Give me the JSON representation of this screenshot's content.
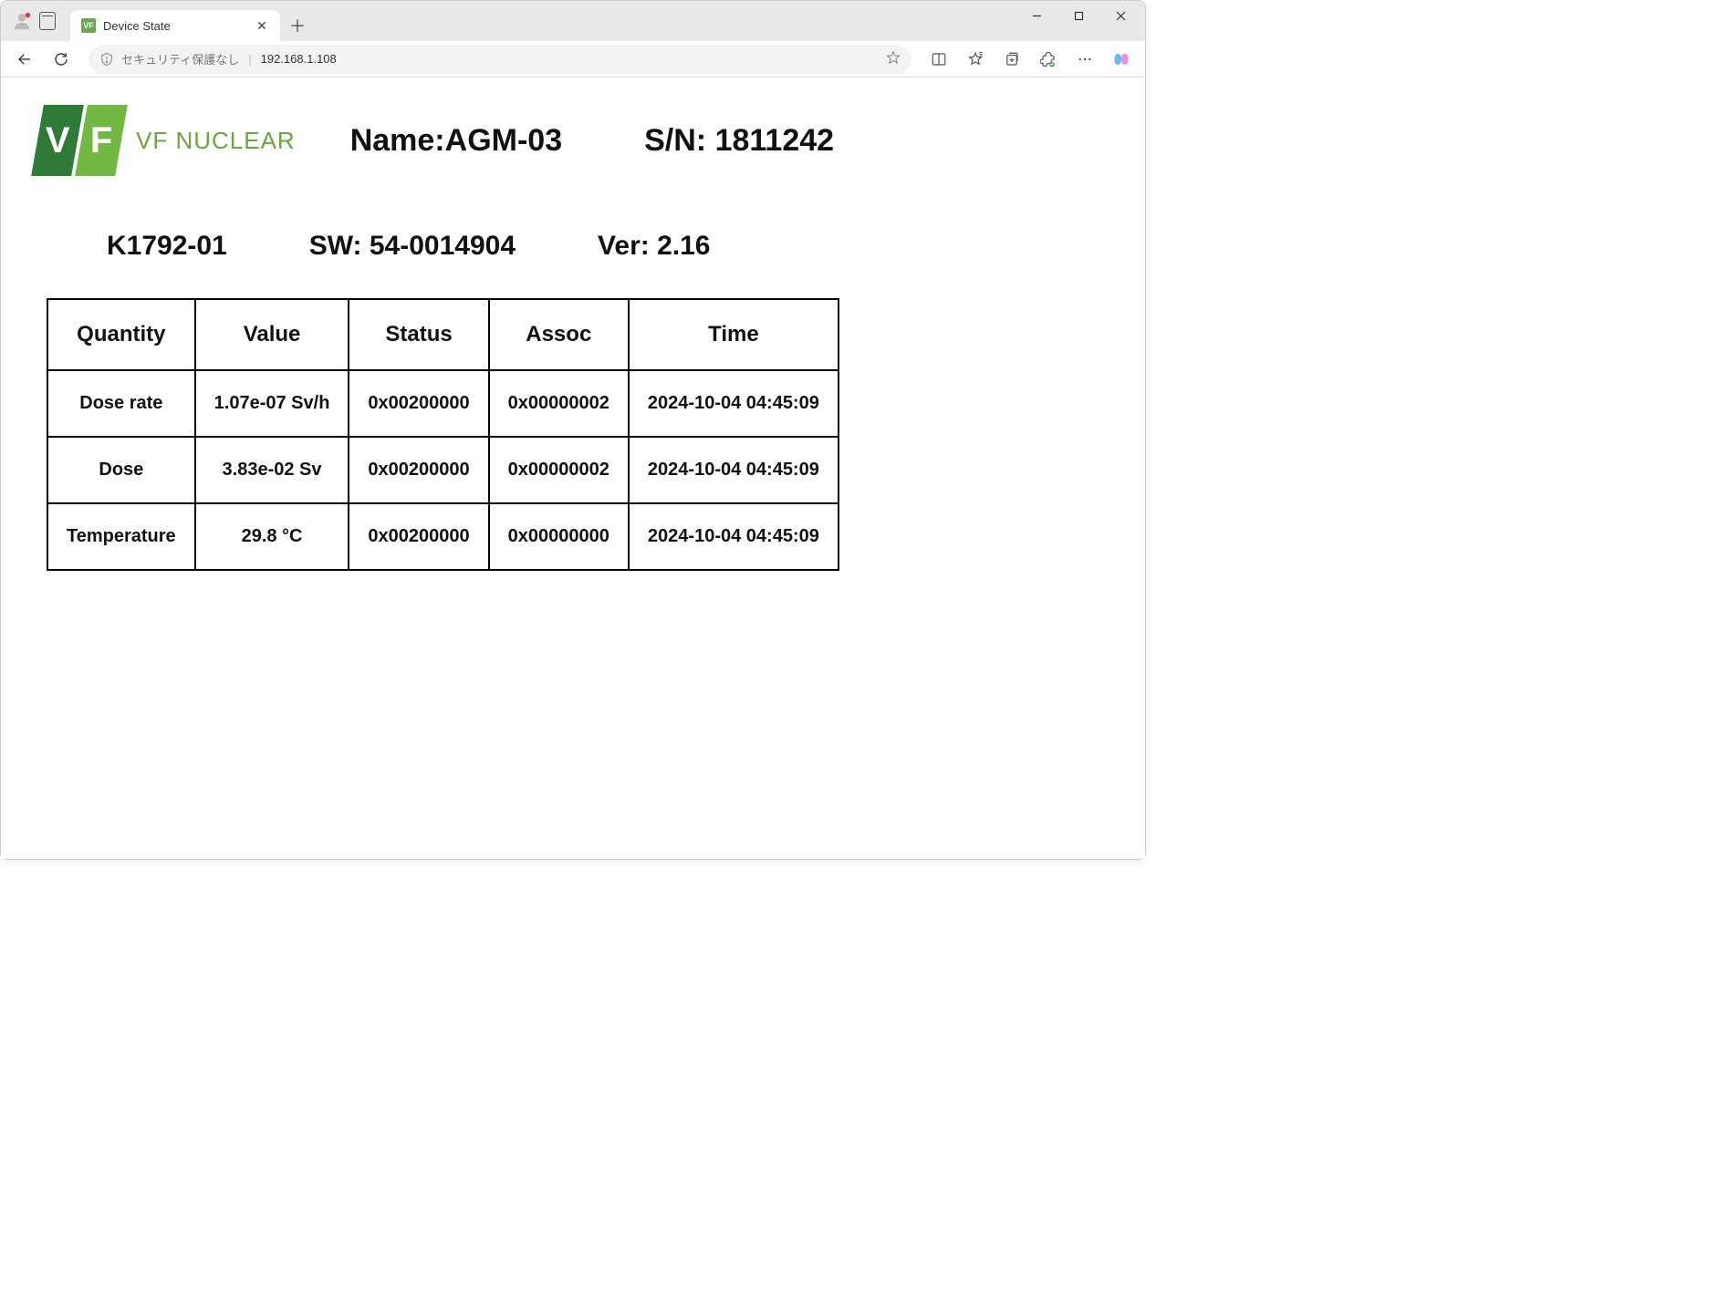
{
  "browser": {
    "tab_title": "Device State",
    "security_text": "セキュリティ保護なし",
    "url": "192.168.1.108"
  },
  "logo": {
    "letter1": "V",
    "letter2": "F",
    "brand_text": "VF NUCLEAR"
  },
  "header": {
    "name_label": "Name:",
    "name_value": "AGM-03",
    "sn_label": "S/N: ",
    "sn_value": "1811242"
  },
  "meta": {
    "model": "K1792-01",
    "sw_label": "SW: ",
    "sw_value": "54-0014904",
    "ver_label": "Ver: ",
    "ver_value": "2.16"
  },
  "table": {
    "headers": [
      "Quantity",
      "Value",
      "Status",
      "Assoc",
      "Time"
    ],
    "rows": [
      {
        "quantity": "Dose rate",
        "value": "1.07e-07 Sv/h",
        "status": "0x00200000",
        "assoc": "0x00000002",
        "time": "2024-10-04 04:45:09"
      },
      {
        "quantity": "Dose",
        "value": "3.83e-02 Sv",
        "status": "0x00200000",
        "assoc": "0x00000002",
        "time": "2024-10-04 04:45:09"
      },
      {
        "quantity": "Temperature",
        "value": "29.8 °C",
        "status": "0x00200000",
        "assoc": "0x00000000",
        "time": "2024-10-04 04:45:09"
      }
    ]
  }
}
